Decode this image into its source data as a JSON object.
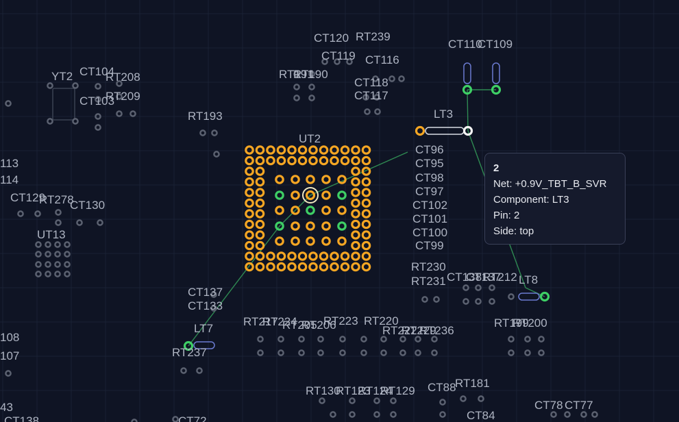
{
  "colors": {
    "background": "#0f1424",
    "grid": "#1a2134",
    "pad_dim": "#5b6170",
    "pad_orange": "#f5a623",
    "pad_green": "#3ecf65",
    "trace": "#2f8a52",
    "body_outline": "#6b7bd1",
    "label": "#aeb4c2"
  },
  "labels": [
    "YT2",
    "CT104",
    "RT208",
    "CT103",
    "RT209",
    "RT193",
    "CT120",
    "RT239",
    "CT119",
    "RT190",
    "RT191",
    "CT116",
    "CT118",
    "CT117",
    "CT110",
    "CT109",
    "LT3",
    "UT2",
    "CT96",
    "CT95",
    "CT98",
    "CT97",
    "CT102",
    "CT101",
    "CT100",
    "CT99",
    "RT230",
    "RT231",
    "CT138",
    "CT137",
    "RT212",
    "LT8",
    "CT137",
    "CT133",
    "LT7",
    "RT237",
    "113",
    "114",
    "CT129",
    "RT278",
    "CT130",
    "UT13",
    "108",
    "107",
    "RT217",
    "RT224",
    "RT205",
    "RT206",
    "RT223",
    "RT220",
    "RT222",
    "RT229",
    "RT236",
    "RT199",
    "RT200",
    "RT130",
    "RT123",
    "RT124",
    "RT129",
    "CT88",
    "RT181",
    "CT84",
    "CT78",
    "CT77",
    "43",
    "CT138",
    "CT72"
  ],
  "tooltip": {
    "title": "2",
    "net": "Net: +0.9V_TBT_B_SVR",
    "component": "Component: LT3",
    "pin": "Pin: 2",
    "side": "Side: top"
  }
}
